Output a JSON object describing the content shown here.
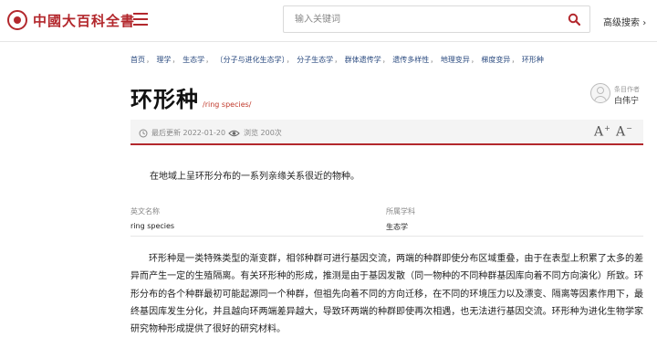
{
  "header": {
    "logo_text": "中國大百科全書",
    "search_placeholder": "输入关键词",
    "advanced_search_label": "高级搜索",
    "advanced_search_chevron": "›"
  },
  "breadcrumb": [
    "首页",
    "理学",
    "生态学",
    "〔分子与进化生态学〕",
    "分子生态学",
    "群体遗传学",
    "遗传多样性",
    "地理变异",
    "梯度变异",
    "环形种"
  ],
  "article": {
    "title": "环形种",
    "title_en": "/ring species/",
    "author_role": "条目作者",
    "author_name": "白伟宁",
    "last_updated": "最后更新 2022-01-20",
    "views": "浏览 200次",
    "font_increase_label": "A",
    "font_increase_sign": "+",
    "font_decrease_label": "A",
    "font_decrease_sign": "−",
    "summary": "在地域上呈环形分布的一系列亲缘关系很近的物种。",
    "info": {
      "en_name_label": "英文名称",
      "en_name_value": "ring species",
      "discipline_label": "所属学科",
      "discipline_value": "生态学"
    },
    "body": "环形种是一类特殊类型的渐变群，相邻种群可进行基因交流，两端的种群即使分布区域重叠，由于在表型上积累了太多的差异而产生一定的生殖隔离。有关环形种的形成，推测是由于基因发散（同一物种的不同种群基因库向着不同方向演化）所致。环形分布的各个种群最初可能起源同一个种群，但祖先向着不同的方向迁移，在不同的环境压力以及漂变、隔离等因素作用下，最终基因库发生分化，并且越向环两端差异越大，导致环两端的种群即使再次相遇，也无法进行基因交流。环形种为进化生物学家研究物种形成提供了很好的研究材料。"
  },
  "colors": {
    "brand_red": "#b3282d",
    "link_blue": "#2a4a7f"
  }
}
